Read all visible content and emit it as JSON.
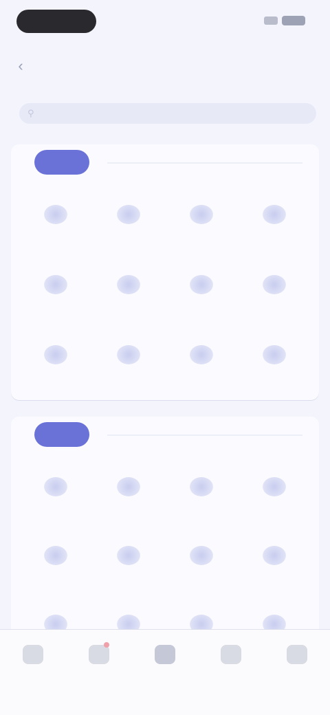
{
  "status_bar": {
    "time": "",
    "signal_icon": "signal-icon",
    "battery_icon": "battery-icon"
  },
  "nav": {
    "title": "",
    "back_icon": "back-arrow-icon"
  },
  "search": {
    "placeholder": "",
    "icon": "search-icon"
  },
  "sections": [
    {
      "tag": "",
      "more": "",
      "items": [
        {
          "label": "",
          "icon": "app-icon"
        },
        {
          "label": "",
          "icon": "app-icon"
        },
        {
          "label": "",
          "icon": "app-icon"
        },
        {
          "label": "",
          "icon": "app-icon"
        },
        {
          "label": "",
          "icon": "app-icon"
        },
        {
          "label": "",
          "icon": "app-icon"
        },
        {
          "label": "",
          "icon": "app-icon"
        },
        {
          "label": "",
          "icon": "app-icon"
        },
        {
          "label": "",
          "icon": "app-icon"
        },
        {
          "label": "",
          "icon": "app-icon"
        },
        {
          "label": "",
          "icon": "app-icon"
        },
        {
          "label": "",
          "icon": "app-icon"
        }
      ]
    },
    {
      "tag": "",
      "more": "",
      "items": [
        {
          "label": "",
          "icon": "app-icon"
        },
        {
          "label": "",
          "icon": "app-icon"
        },
        {
          "label": "",
          "icon": "app-icon"
        },
        {
          "label": "",
          "icon": "app-icon"
        },
        {
          "label": "",
          "icon": "app-icon"
        },
        {
          "label": "",
          "icon": "app-icon"
        },
        {
          "label": "",
          "icon": "app-icon"
        },
        {
          "label": "",
          "icon": "app-icon"
        },
        {
          "label": "",
          "icon": "app-icon"
        },
        {
          "label": "",
          "icon": "app-icon"
        },
        {
          "label": "",
          "icon": "app-icon"
        },
        {
          "label": "",
          "icon": "app-icon"
        }
      ]
    }
  ],
  "tab_bar": {
    "items": [
      {
        "label": "",
        "icon": "home-icon"
      },
      {
        "label": "",
        "icon": "message-icon",
        "badge": true
      },
      {
        "label": "",
        "icon": "grid-icon",
        "active": true
      },
      {
        "label": "",
        "icon": "cart-icon"
      },
      {
        "label": "",
        "icon": "profile-icon"
      }
    ]
  },
  "colors": {
    "background": "#f4f5fc",
    "accent": "#6a72d8",
    "badge": "#f0a0a8"
  }
}
